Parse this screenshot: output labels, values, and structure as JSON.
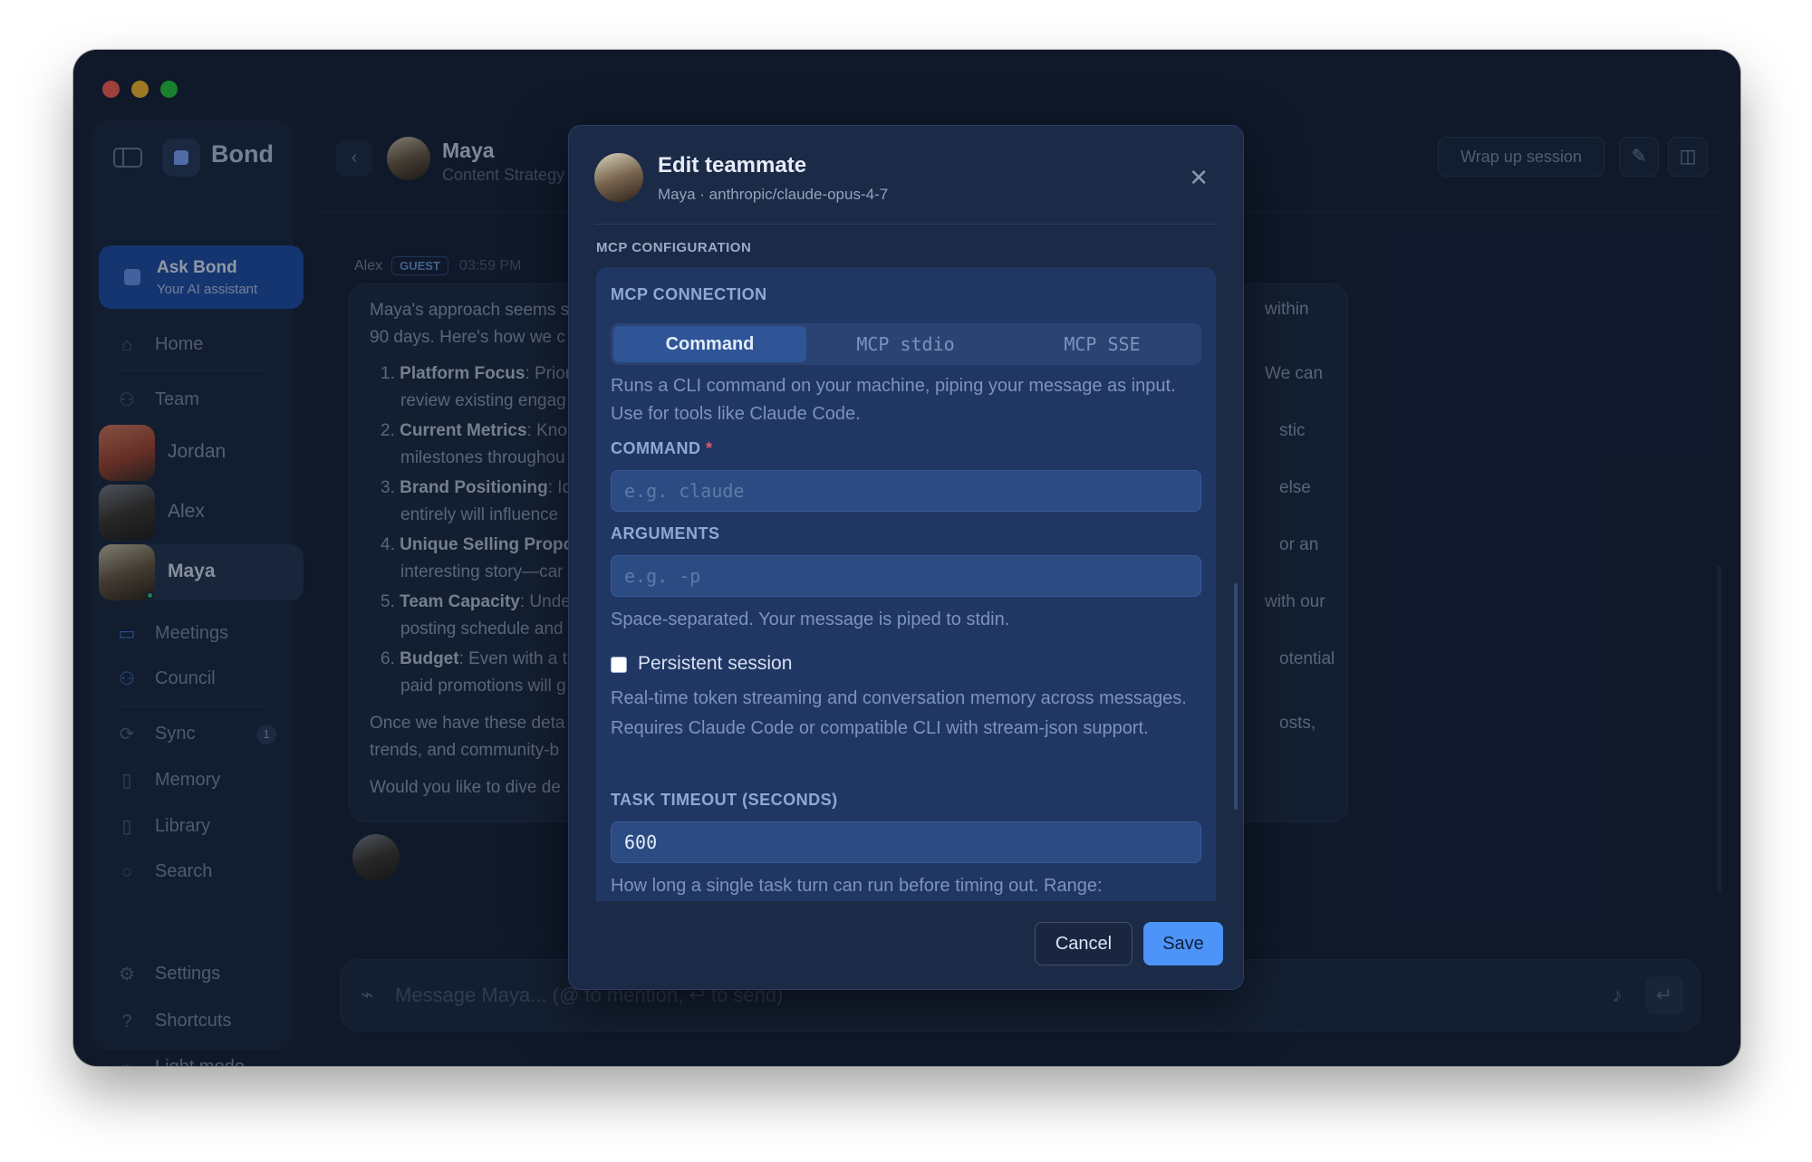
{
  "sidebar": {
    "brand": "Bond",
    "ask_bond": {
      "title": "Ask Bond",
      "subtitle": "Your AI assistant"
    },
    "nav": {
      "home": "Home",
      "team": "Team",
      "meetings": "Meetings",
      "council": "Council",
      "sync": "Sync",
      "sync_badge": "1",
      "memory": "Memory",
      "library": "Library",
      "search": "Search",
      "settings": "Settings",
      "shortcuts": "Shortcuts",
      "light_mode": "Light mode"
    },
    "members": [
      {
        "name": "Jordan"
      },
      {
        "name": "Alex"
      },
      {
        "name": "Maya"
      }
    ]
  },
  "header": {
    "name": "Maya",
    "role": "Content Strategy",
    "wrap_up": "Wrap up session"
  },
  "message": {
    "author": "Alex",
    "badge": "GUEST",
    "time": "03:59 PM",
    "intro_1": "Maya's approach seems s",
    "intro_2": "90 days. Here's how we c",
    "items": [
      {
        "num": "1.",
        "bold": "Platform Focus",
        "rest": ": Prior",
        "line2": "review existing engag"
      },
      {
        "num": "2.",
        "bold": "Current Metrics",
        "rest": ": Kno",
        "line2": "milestones throughou"
      },
      {
        "num": "3.",
        "bold": "Brand Positioning",
        "rest": ": Id",
        "line2": "entirely will influence"
      },
      {
        "num": "4.",
        "bold": "Unique Selling Propo",
        "rest": "",
        "line2": "interesting story—car"
      },
      {
        "num": "5.",
        "bold": "Team Capacity",
        "rest": ": Unde",
        "line2": "posting schedule and"
      },
      {
        "num": "6.",
        "bold": "Budget",
        "rest": ": Even with a ti",
        "line2": "paid promotions will g"
      }
    ],
    "outro_1": "Once we have these deta",
    "outro_2": "trends, and community-b",
    "outro_3": "Would you like to dive de",
    "right_fragments": [
      "within",
      "We can",
      "stic",
      "else",
      "or an",
      "with our",
      "otential",
      "osts,"
    ]
  },
  "composer": {
    "placeholder": "Message Maya... (@ to mention, ↩ to send)"
  },
  "modal": {
    "title": "Edit teammate",
    "subtitle": "Maya · anthropic/claude-opus-4-7",
    "section": "MCP CONFIGURATION",
    "connection_label": "MCP CONNECTION",
    "tabs": [
      "Command",
      "MCP stdio",
      "MCP SSE"
    ],
    "tab_desc": "Runs a CLI command on your machine, piping your message as input. Use for tools like Claude Code.",
    "command_label": "COMMAND",
    "required_mark": "*",
    "command_placeholder": "e.g. claude",
    "arguments_label": "ARGUMENTS",
    "arguments_placeholder": "e.g. -p",
    "arguments_help": "Space-separated. Your message is piped to stdin.",
    "persistent_label": "Persistent session",
    "persistent_checked": false,
    "persistent_help": "Real-time token streaming and conversation memory across messages. Requires Claude Code or compatible CLI with stream-json support.",
    "timeout_label": "TASK TIMEOUT (SECONDS)",
    "timeout_value": "600",
    "timeout_help": "How long a single task turn can run before timing out. Range:",
    "cancel": "Cancel",
    "save": "Save"
  },
  "colors": {
    "accent": "#4c94f7",
    "window_bg": "#152136",
    "modal_bg": "#1b2a47",
    "required": "#e05a6a",
    "online": "#34c46c"
  }
}
